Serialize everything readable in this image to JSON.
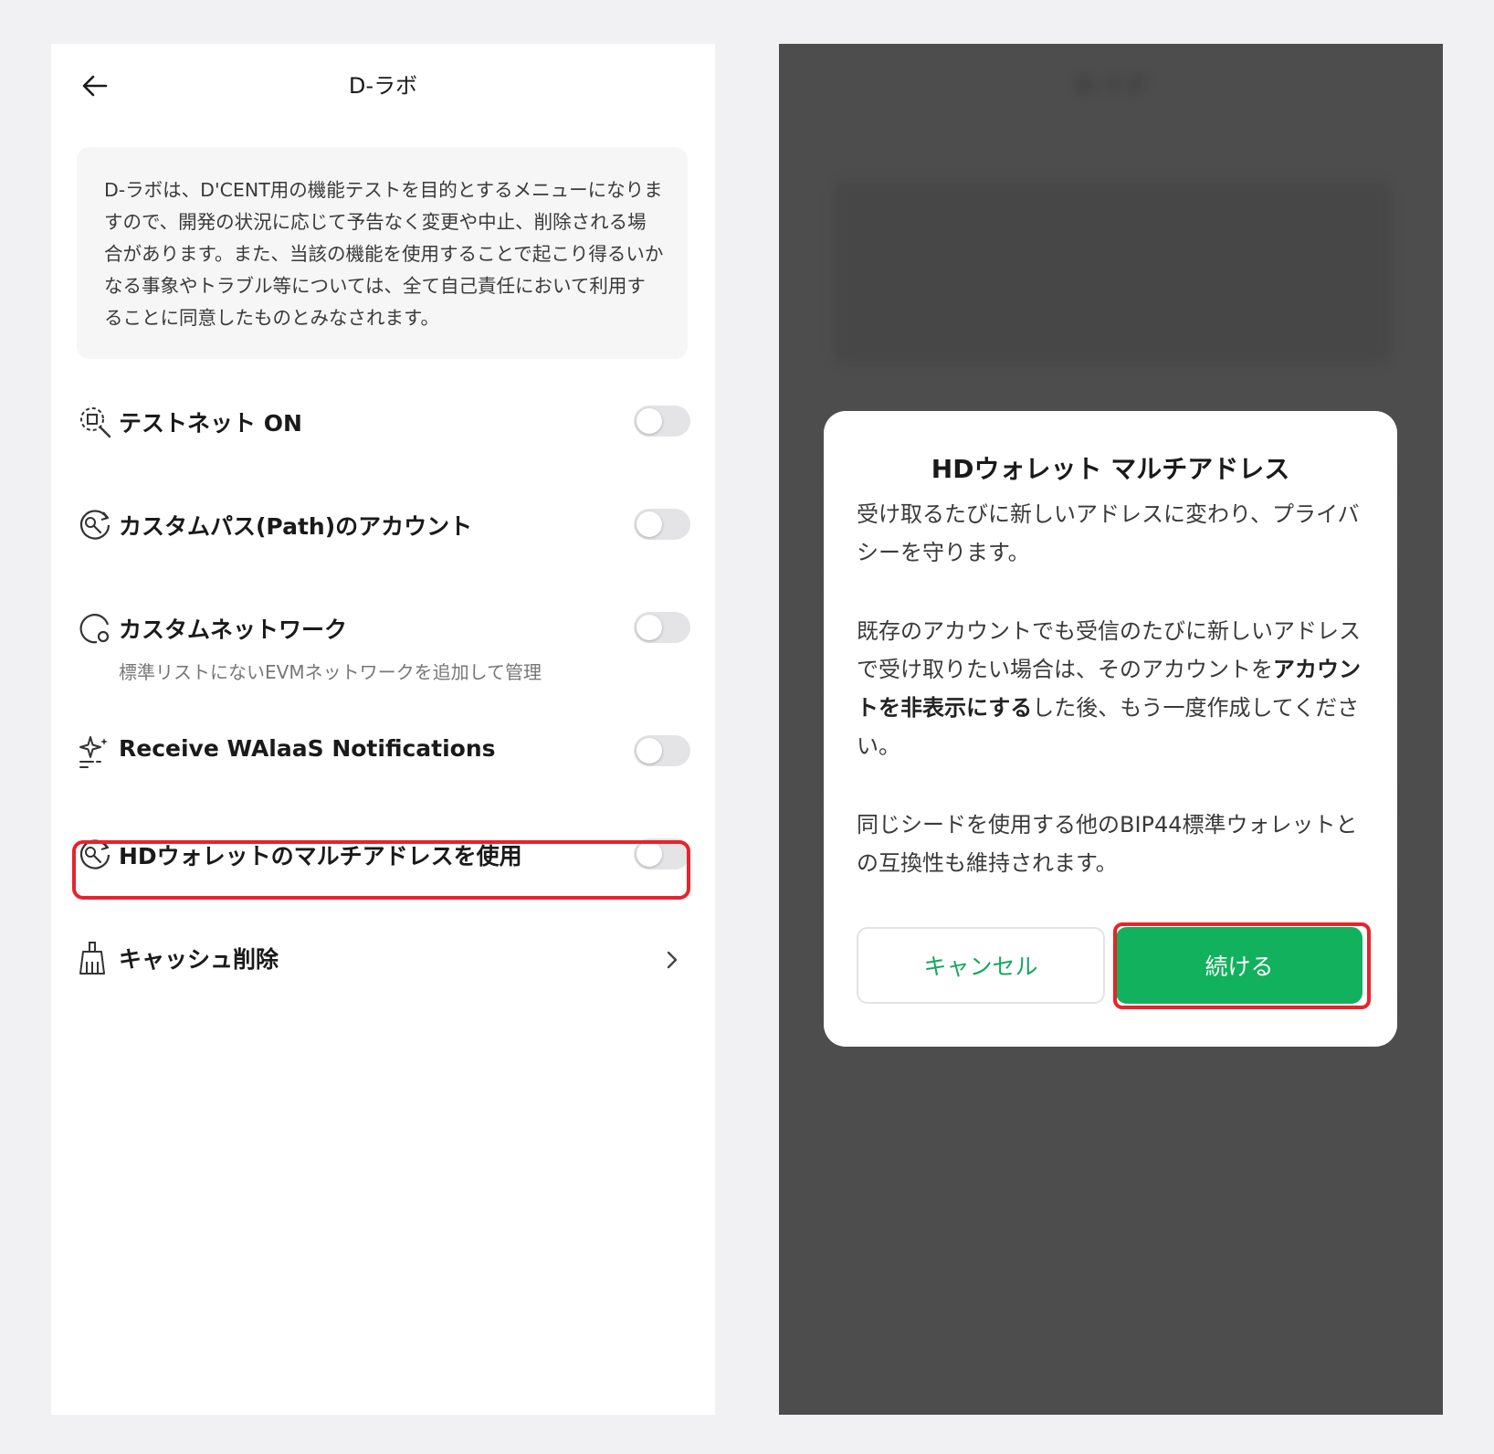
{
  "left": {
    "header": {
      "title": "D-ラボ"
    },
    "notice": "D-ラボは、D'CENT用の機能テストを目的とするメニューになりますので、開発の状況に応じて予告なく変更や中止、削除される場合があります。また、当該の機能を使用することで起こり得るいかなる事象やトラブル等については、全て自己責任において利用することに同意したものとみなされます。",
    "settings": [
      {
        "label": "テストネット ON",
        "icon": "testnet-icon",
        "state": "off"
      },
      {
        "label": "カスタムパス(Path)のアカウント",
        "icon": "custom-path-icon",
        "state": "off"
      },
      {
        "label": "カスタムネットワーク",
        "sub": "標準リストにないEVMネットワークを追加して管理",
        "icon": "network-icon",
        "state": "off"
      },
      {
        "label": "Receive WAlaaS Notifications",
        "icon": "sparkle-icon",
        "state": "off"
      },
      {
        "label": "HDウォレットのマルチアドレスを使用",
        "icon": "multi-address-icon",
        "state": "off",
        "highlighted": true
      },
      {
        "label": "キャッシュ削除",
        "icon": "broom-icon",
        "action": "chevron"
      }
    ]
  },
  "right": {
    "blurred_title": "D-ラボ",
    "modal": {
      "title": "HDウォレット マルチアドレス",
      "p1": "受け取るたびに新しいアドレスに変わり、プライバシーを守ります。",
      "p2_pre": "既存のアカウントでも受信のたびに新しいアドレスで受け取りたい場合は、そのアカウントを",
      "p2_bold": "アカウントを非表示にする",
      "p2_post": "した後、もう一度作成してください。",
      "p3": "同じシードを使用する他のBIP44標準ウォレットとの互換性も維持されます。",
      "cancel_label": "キャンセル",
      "continue_label": "続ける"
    }
  },
  "colors": {
    "accent_green": "#12b15e",
    "highlight_red": "#e8232b",
    "overlay": "#4d4d4d"
  }
}
